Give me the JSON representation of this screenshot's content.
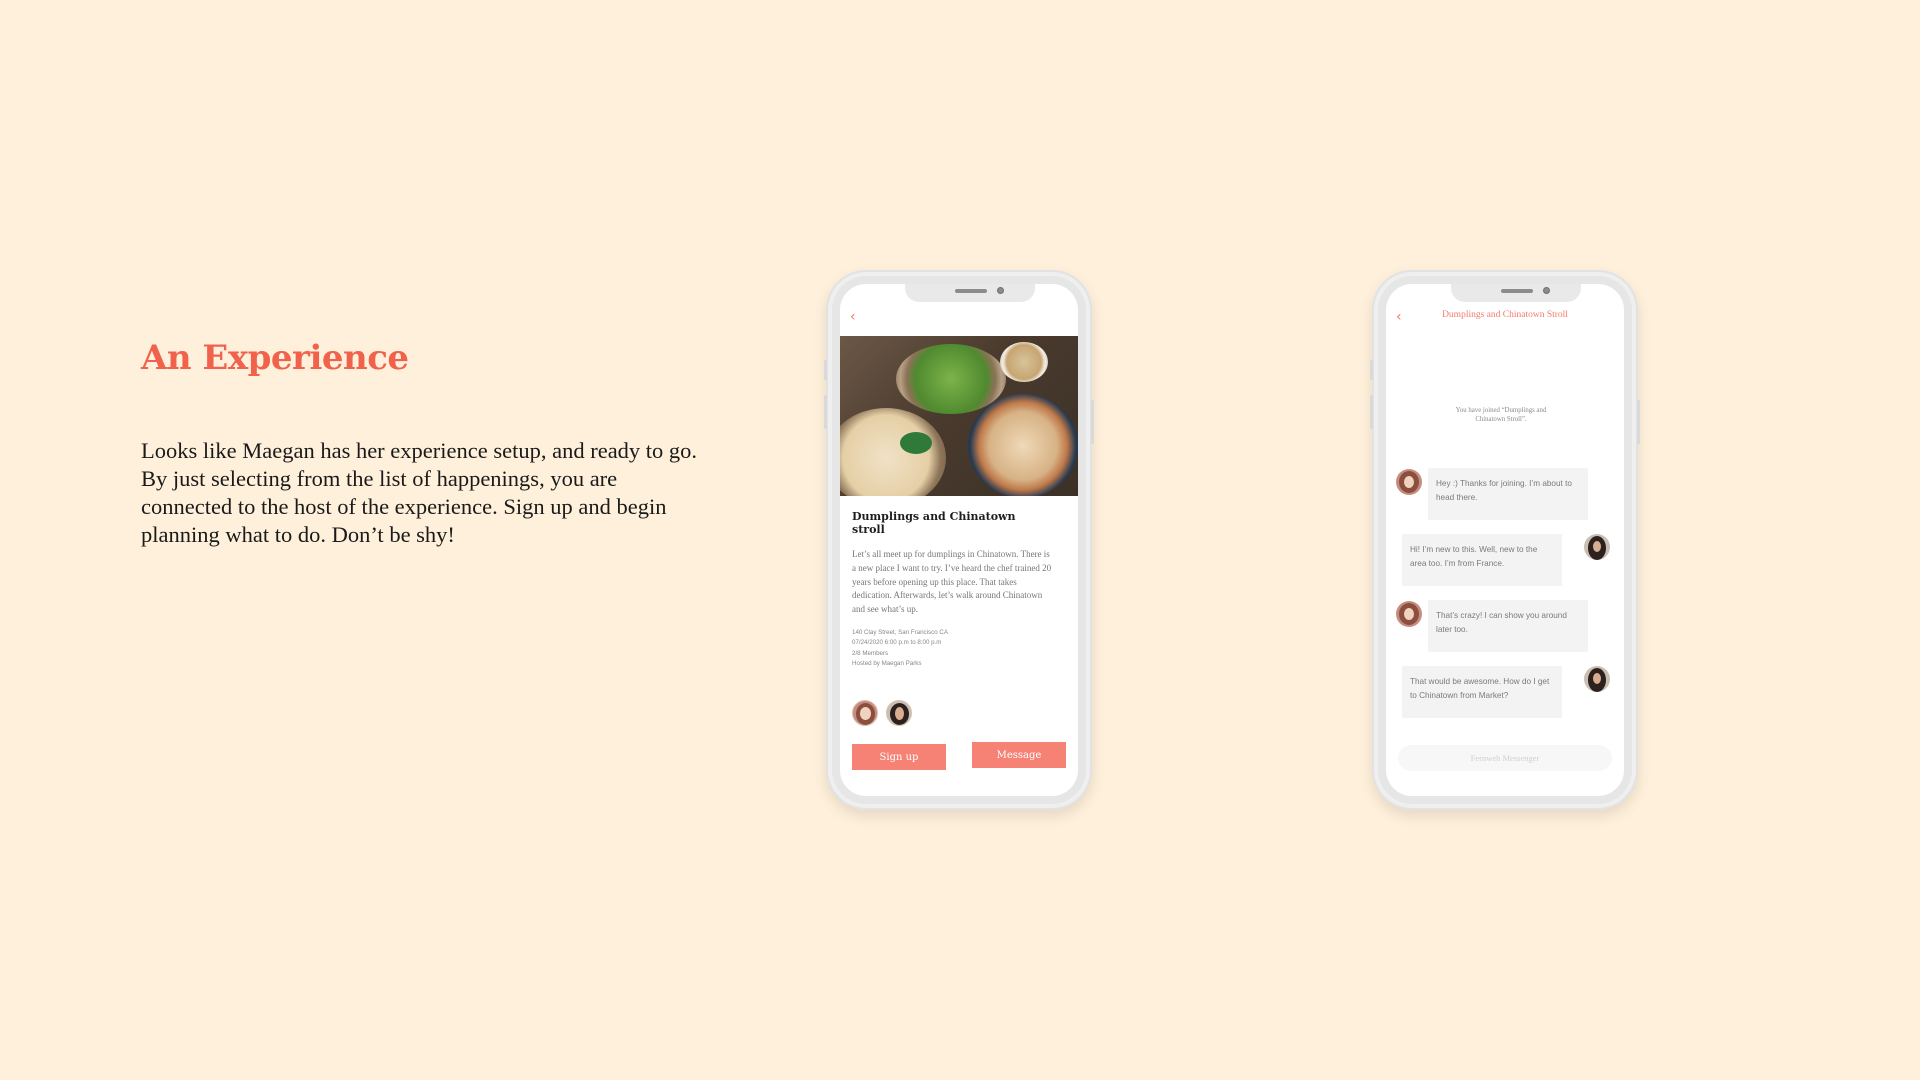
{
  "slide": {
    "heading": "An Experience",
    "body": "Looks like Maegan has her experience setup, and ready to go. By just selecting from the list of happenings, you are connected to the host of the experience. Sign up and begin planning what to do. Don’t be shy!"
  },
  "detail": {
    "back_icon": "‹",
    "title": "Dumplings and Chinatown stroll",
    "description": "Let’s all meet up for dumplings in Chinatown. There is a new place I want to try. I’ve heard the chef trained 20 years before opening up this place. That takes dedication. Afterwards, let’s walk around Chinatown and see what’s up.",
    "address": "140 Clay Street, San Francisco CA",
    "datetime": "07/24/2020 6:00 p.m to 8:00 p.m",
    "members": "2/8 Members",
    "host": "Hosted by Maegan Parks",
    "signup_label": "Sign up",
    "message_label": "Message"
  },
  "chat": {
    "back_icon": "‹",
    "title": "Dumplings and Chinatown Stroll",
    "system": "You have joined “Dumplings and Chinatown Stroll”.",
    "messages": [
      {
        "from": "host",
        "text": "Hey :) Thanks for joining. I’m about to head there."
      },
      {
        "from": "me",
        "text": "Hi! I’m new to this. Well, new to the area too. I’m from France."
      },
      {
        "from": "host",
        "text": "That’s crazy! I can show you around later too."
      },
      {
        "from": "me",
        "text": "That would be awesome. How do I get to Chinatown from Market?"
      }
    ],
    "composer_placeholder": "Fernweh Messenger"
  },
  "colors": {
    "background": "#fef0da",
    "accent": "#f0624c",
    "button": "#f58275"
  }
}
